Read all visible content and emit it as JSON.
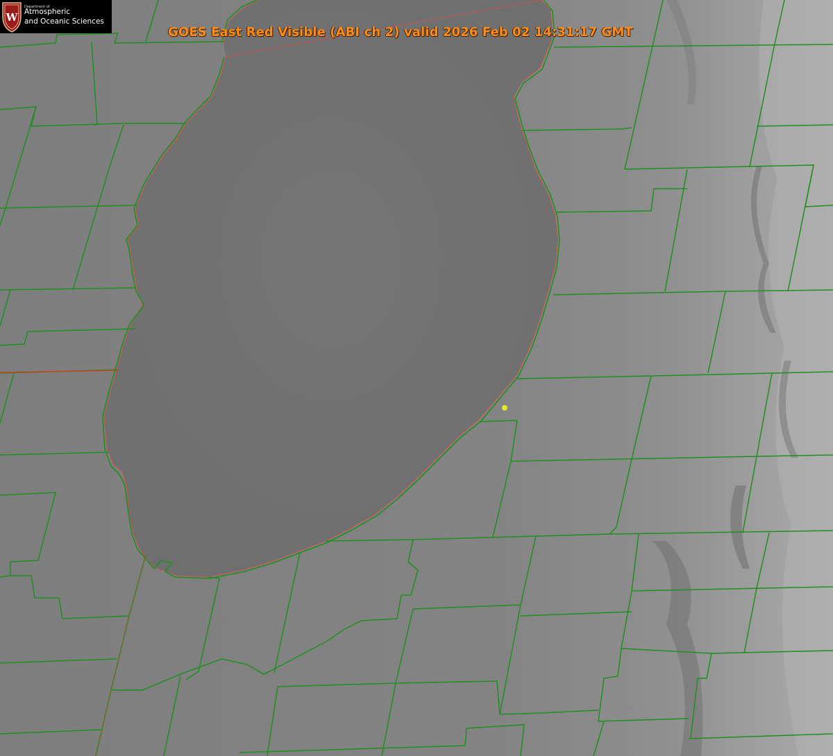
{
  "title": "GOES East Red Visible (ABI ch 2) valid 2026 Feb 02 14:31:17 GMT",
  "logo": {
    "small_text": "Department of",
    "line1": "Atmospheric",
    "line2": "and Oceanic Sciences",
    "icon": "uw-crest-icon",
    "crest_letter": "W"
  },
  "colors": {
    "title": "#ff8c1a",
    "county_lines": "#1f8f1f",
    "coastline": "#ff4040",
    "marker": "#e6e62e",
    "lake": "#737373",
    "land": "#828282",
    "cloud": "#a8a8a8",
    "logo_crest": "#9b1b1b"
  },
  "map": {
    "projection_area": "Lake Michigan and surrounding counties",
    "marker_icon": "yellow-dot-marker"
  }
}
